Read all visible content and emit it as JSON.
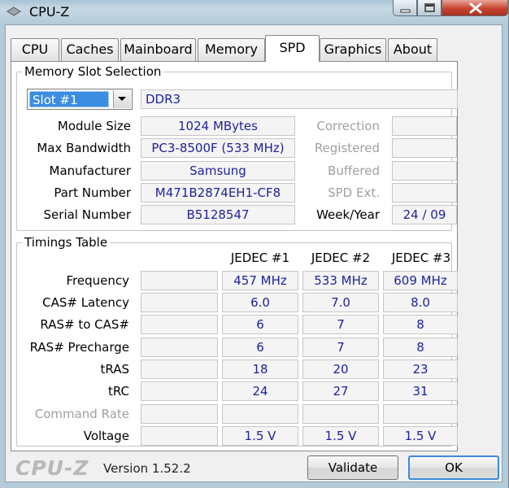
{
  "window": {
    "title": "CPU-Z"
  },
  "tabs": [
    {
      "label": "CPU"
    },
    {
      "label": "Caches"
    },
    {
      "label": "Mainboard"
    },
    {
      "label": "Memory"
    },
    {
      "label": "SPD",
      "active": true
    },
    {
      "label": "Graphics"
    },
    {
      "label": "About"
    }
  ],
  "slot_section": {
    "title": "Memory Slot Selection",
    "slot_value": "Slot #1",
    "memory_type": "DDR3",
    "rows": [
      {
        "label": "Module Size",
        "value": "1024 MBytes",
        "right_label": "Correction",
        "right_value": ""
      },
      {
        "label": "Max Bandwidth",
        "value": "PC3-8500F (533 MHz)",
        "right_label": "Registered",
        "right_value": ""
      },
      {
        "label": "Manufacturer",
        "value": "Samsung",
        "right_label": "Buffered",
        "right_value": ""
      },
      {
        "label": "Part Number",
        "value": "M471B2874EH1-CF8",
        "right_label": "SPD Ext.",
        "right_value": ""
      },
      {
        "label": "Serial Number",
        "value": "B5128547",
        "right_label": "Week/Year",
        "right_value": "24 / 09"
      }
    ]
  },
  "timings": {
    "title": "Timings Table",
    "columns": [
      "JEDEC #1",
      "JEDEC #2",
      "JEDEC #3"
    ],
    "rows": [
      {
        "label": "Frequency",
        "values": [
          "457 MHz",
          "533 MHz",
          "609 MHz"
        ]
      },
      {
        "label": "CAS# Latency",
        "values": [
          "6.0",
          "7.0",
          "8.0"
        ]
      },
      {
        "label": "RAS# to CAS#",
        "values": [
          "6",
          "7",
          "8"
        ]
      },
      {
        "label": "RAS# Precharge",
        "values": [
          "6",
          "7",
          "8"
        ]
      },
      {
        "label": "tRAS",
        "values": [
          "18",
          "20",
          "23"
        ]
      },
      {
        "label": "tRC",
        "values": [
          "24",
          "27",
          "31"
        ]
      },
      {
        "label": "Command Rate",
        "values": [
          "",
          "",
          ""
        ]
      },
      {
        "label": "Voltage",
        "values": [
          "1.5 V",
          "1.5 V",
          "1.5 V"
        ]
      }
    ]
  },
  "footer": {
    "brand": "CPU-Z",
    "version": "Version 1.52.2",
    "validate_label": "Validate",
    "ok_label": "OK"
  }
}
